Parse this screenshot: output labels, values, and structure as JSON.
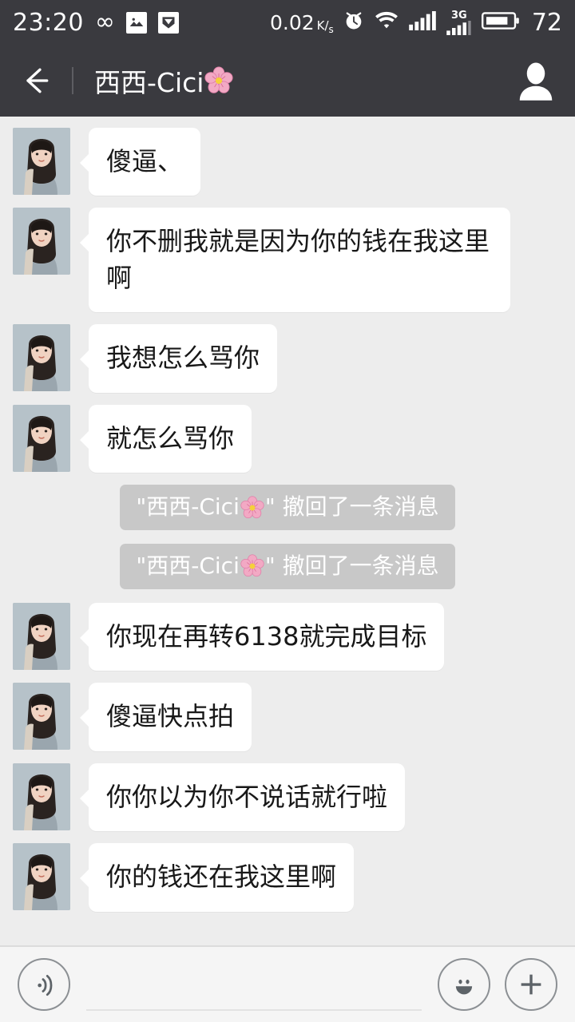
{
  "status_bar": {
    "time": "23:20",
    "network_speed": "0.02",
    "network_speed_unit_top": "K",
    "network_speed_unit_bottom": "s",
    "battery_level": "72",
    "signal_label": "3G",
    "icons": [
      "infinity-icon",
      "photo-icon",
      "download-badge-icon",
      "alarm-clock-icon",
      "wifi-icon",
      "signal-bars-icon",
      "signal-3g-icon",
      "battery-icon"
    ],
    "bg_color": "#3a3a3f",
    "fg_color": "#ffffff"
  },
  "nav_bar": {
    "back_label": "back-arrow",
    "title": "西西-Cici",
    "title_emoji": "cherry-blossom",
    "profile_label": "contact-profile",
    "bg_color": "#3a3a3f"
  },
  "conversation": {
    "contact_name": "西西-Cici",
    "bubble_color": "#ffffff",
    "background_color": "#ededed",
    "system_bubble_color": "#c8c8c8",
    "messages": [
      {
        "type": "incoming",
        "text": "傻逼、"
      },
      {
        "type": "incoming",
        "text": "你不删我就是因为你的钱在我这里啊"
      },
      {
        "type": "incoming",
        "text": "我想怎么骂你"
      },
      {
        "type": "incoming",
        "text": "就怎么骂你"
      },
      {
        "type": "system",
        "prefix": "\"西西-Cici",
        "suffix": "\" 撤回了一条消息"
      },
      {
        "type": "system",
        "prefix": "\"西西-Cici",
        "suffix": "\" 撤回了一条消息"
      },
      {
        "type": "incoming",
        "text": "你现在再转6138就完成目标"
      },
      {
        "type": "incoming",
        "text": "傻逼快点拍"
      },
      {
        "type": "incoming",
        "text": "你你以为你不说话就行啦"
      },
      {
        "type": "incoming",
        "text": "你的钱还在我这里啊"
      }
    ]
  },
  "input_bar": {
    "voice_button_label": "voice-input",
    "message_value": "",
    "message_placeholder": "",
    "emoji_button_label": "emoji-picker",
    "more_button_label": "more-actions",
    "bg_color": "#f5f5f5"
  }
}
